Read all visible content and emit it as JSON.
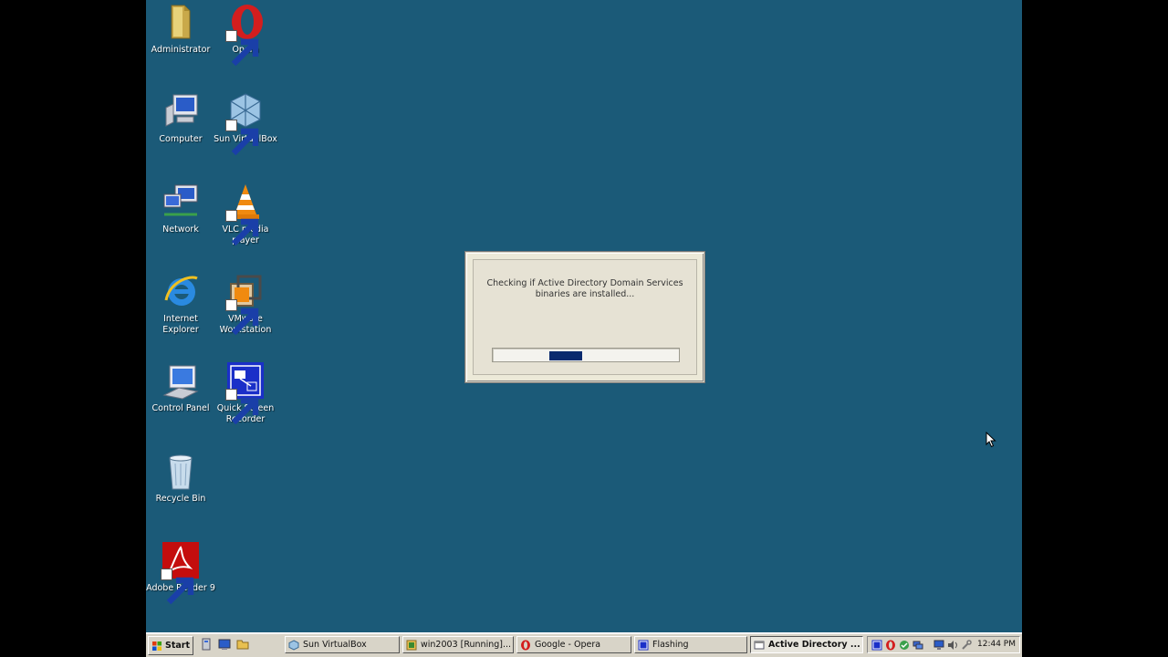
{
  "desktop": {
    "background": "#1b5a78",
    "icons": [
      {
        "name": "administrator-icon",
        "label": "Administrator",
        "icon": "folder-icon"
      },
      {
        "name": "opera-icon",
        "label": "Opera",
        "icon": "opera-icon"
      },
      {
        "name": "computer-icon",
        "label": "Computer",
        "icon": "computer-icon"
      },
      {
        "name": "virtualbox-icon",
        "label": "Sun VirtualBox",
        "icon": "virtualbox-icon"
      },
      {
        "name": "network-icon",
        "label": "Network",
        "icon": "network-icon"
      },
      {
        "name": "vlc-icon",
        "label": "VLC media player",
        "icon": "vlc-cone-icon"
      },
      {
        "name": "ie-icon",
        "label": "Internet Explorer",
        "icon": "internet-explorer-icon"
      },
      {
        "name": "vmware-icon",
        "label": "VMware Workstation",
        "icon": "vmware-icon"
      },
      {
        "name": "control-panel-icon",
        "label": "Control Panel",
        "icon": "control-panel-icon"
      },
      {
        "name": "quick-screen-recorder-icon",
        "label": "Quick Screen Recorder",
        "icon": "screen-recorder-icon"
      },
      {
        "name": "recycle-bin-icon",
        "label": "Recycle Bin",
        "icon": "recycle-bin-icon"
      },
      {
        "name": "adobe-reader-icon",
        "label": "Adobe Reader 9",
        "icon": "adobe-reader-icon"
      }
    ]
  },
  "dialog": {
    "message": "Checking if Active Directory Domain Services\nbinaries are installed...",
    "progress_style": "marquee",
    "progress_color": "#0a2a6e"
  },
  "taskbar": {
    "start_label": "Start",
    "quick_launch": [
      "server-manager-icon",
      "show-desktop-icon",
      "windows-explorer-icon"
    ],
    "tasks": [
      {
        "label": "Sun VirtualBox",
        "icon": "virtualbox-icon",
        "active": false
      },
      {
        "label": "win2003 [Running]...",
        "icon": "vm-window-icon",
        "active": false
      },
      {
        "label": "Google - Opera",
        "icon": "opera-icon",
        "active": false
      },
      {
        "label": "Flashing",
        "icon": "recorder-icon",
        "active": false
      },
      {
        "label": "Active Directory ...",
        "icon": "dialog-window-icon",
        "active": true
      }
    ],
    "tray_icons": [
      "recorder-icon",
      "opera-icon",
      "security-icon",
      "network-icon",
      "volume-icon",
      "power-icon",
      "tool-icon"
    ],
    "clock": "12:44 PM"
  }
}
